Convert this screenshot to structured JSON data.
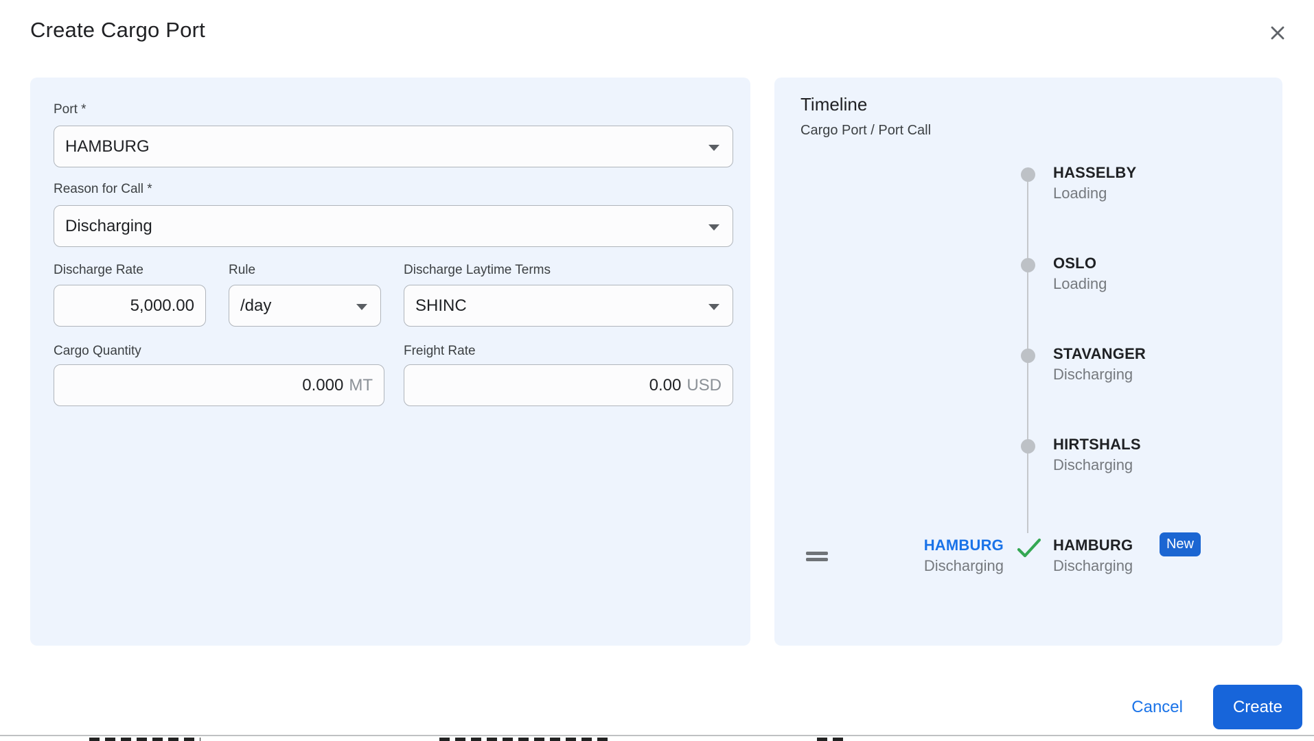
{
  "dialog": {
    "title": "Create Cargo Port"
  },
  "form": {
    "port": {
      "label": "Port *",
      "value": "HAMBURG"
    },
    "reason": {
      "label": "Reason for Call *",
      "value": "Discharging"
    },
    "discharge_rate": {
      "label": "Discharge Rate",
      "value": "5,000.00"
    },
    "rule": {
      "label": "Rule",
      "value": "/day"
    },
    "laytime": {
      "label": "Discharge Laytime Terms",
      "value": "SHINC"
    },
    "cargo_quantity": {
      "label": "Cargo Quantity",
      "value": "0.000",
      "unit": "MT"
    },
    "freight_rate": {
      "label": "Freight Rate",
      "value": "0.00",
      "unit": "USD"
    }
  },
  "timeline": {
    "title": "Timeline",
    "subtitle": "Cargo Port / Port Call",
    "items": [
      {
        "port": "HASSELBY",
        "reason": "Loading"
      },
      {
        "port": "OSLO",
        "reason": "Loading"
      },
      {
        "port": "STAVANGER",
        "reason": "Discharging"
      },
      {
        "port": "HIRTSHALS",
        "reason": "Discharging"
      }
    ],
    "new_item": {
      "cargo_port": "HAMBURG",
      "cargo_reason": "Discharging",
      "port_call": "HAMBURG",
      "port_call_reason": "Discharging",
      "badge": "New"
    }
  },
  "footer": {
    "cancel": "Cancel",
    "create": "Create"
  },
  "icons": {
    "close": "close-icon",
    "dropdown": "chevron-down-icon",
    "drag": "drag-handle-icon",
    "check": "check-icon"
  },
  "colors": {
    "panel_bg": "#eef4fd",
    "accent_blue": "#1a73e8",
    "create_blue": "#1765da",
    "badge_blue": "#1b66d2",
    "check_green": "#34a853",
    "timeline_gray": "#bdc1c6"
  }
}
